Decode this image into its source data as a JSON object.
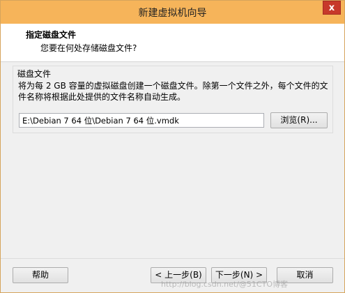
{
  "window": {
    "title": "新建虚拟机向导",
    "close_glyph": "x"
  },
  "header": {
    "title": "指定磁盘文件",
    "subtitle": "您要在何处存储磁盘文件?"
  },
  "disk_group": {
    "label": "磁盘文件",
    "description": "将为每 2 GB 容量的虚拟磁盘创建一个磁盘文件。除第一个文件之外，每个文件的文件名称将根据此处提供的文件名称自动生成。",
    "path_value": "E:\\Debian 7 64 位\\Debian 7 64 位.vmdk",
    "browse_label": "浏览(R)..."
  },
  "footer": {
    "help_label": "帮助",
    "back_label": "< 上一步(B)",
    "next_label": "下一步(N) >",
    "cancel_label": "取消"
  },
  "watermark": "http://blog.csdn.net/@51CTO博客",
  "colors": {
    "titlebar": "#f6b45a",
    "close_button": "#c7392b",
    "dialog_bg": "#f0f0f0"
  }
}
